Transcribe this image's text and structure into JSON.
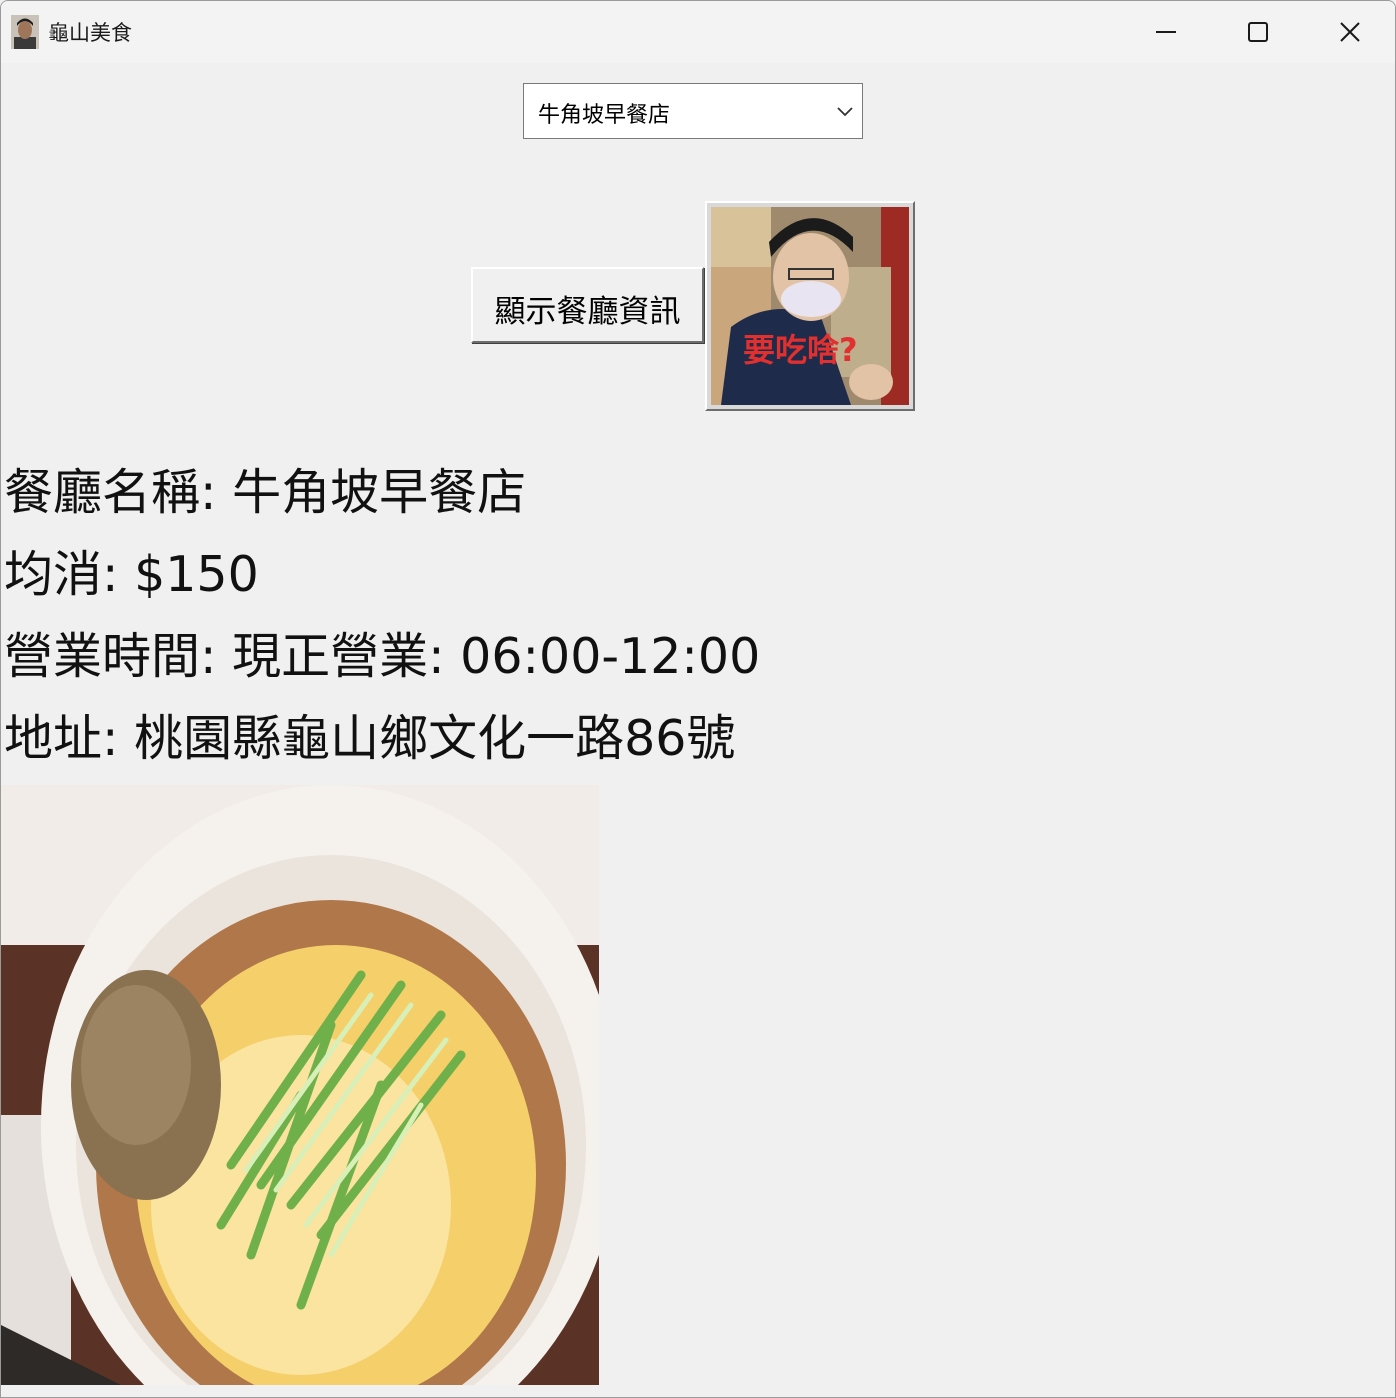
{
  "window": {
    "title": "龜山美食",
    "app_icon": "person-photo-icon",
    "controls": [
      "minimize-icon",
      "maximize-icon",
      "close-icon"
    ]
  },
  "restaurant_select": {
    "selected": "牛角坡早餐店"
  },
  "show_button": {
    "label": "顯示餐廳資訊"
  },
  "photo_button": {
    "caption": "要吃啥?",
    "caption_color": "#e03030"
  },
  "info": {
    "name_line": "餐廳名稱: 牛角坡早餐店",
    "price_line": "均消: $150",
    "hours_line": "營業時間: 現正營業: 06:00-12:00",
    "address_line": "地址: 桃園縣龜山鄉文化一路86號"
  }
}
